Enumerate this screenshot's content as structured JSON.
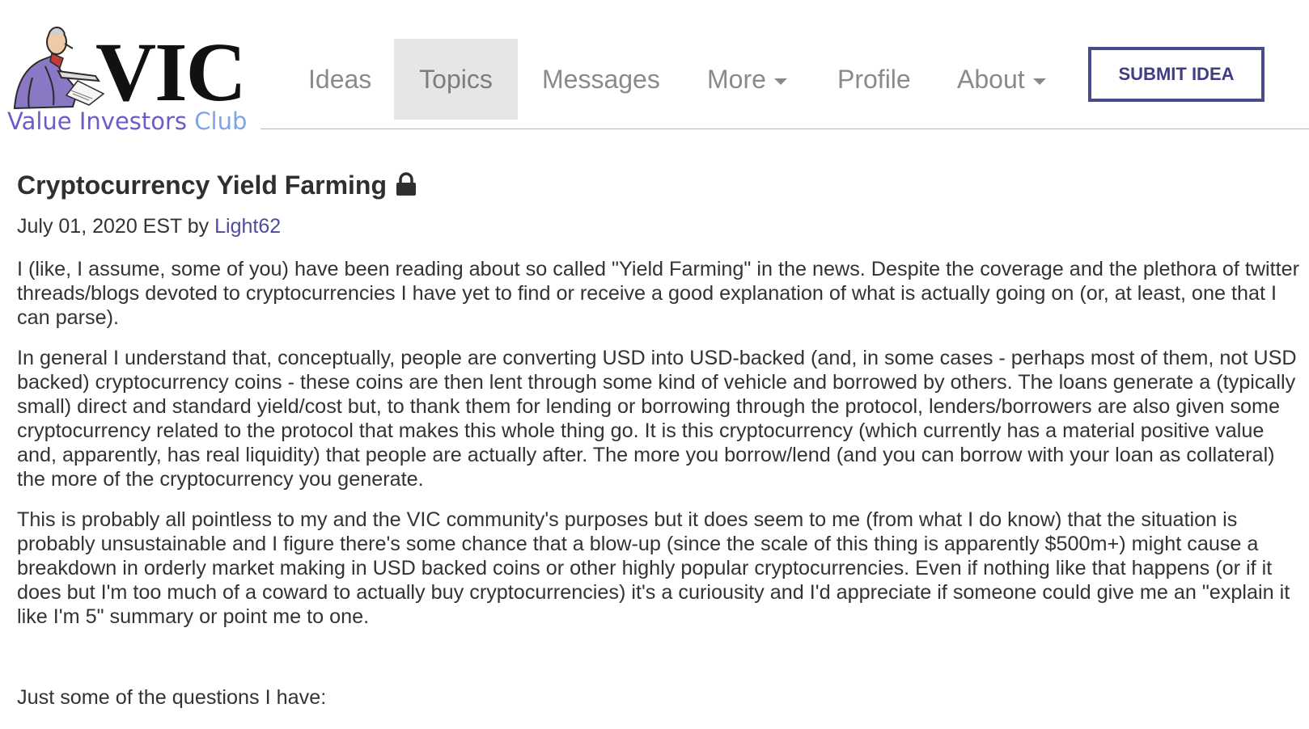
{
  "site": {
    "logo_text": "VIC",
    "tagline_part1": "Value Investors",
    "tagline_part2": "Club"
  },
  "nav": {
    "ideas": "Ideas",
    "topics": "Topics",
    "messages": "Messages",
    "more": "More",
    "profile": "Profile",
    "about": "About",
    "submit": "SUBMIT IDEA",
    "active_item": "Topics"
  },
  "post": {
    "title": "Cryptocurrency Yield Farming",
    "date": "July 01, 2020 EST by ",
    "author": "Light62",
    "paragraphs": [
      "I (like, I assume, some of you) have been reading about so called \"Yield Farming\" in the news.  Despite the coverage and the plethora of twitter threads/blogs devoted to cryptocurrencies I have yet to find or receive a good explanation of what is actually going on (or, at least, one that I can parse).",
      "In general I understand that, conceptually, people are converting USD into USD-backed (and, in some cases - perhaps most of them, not USD backed) cryptocurrency coins - these coins are then lent through some kind of vehicle and borrowed by others.  The loans generate a (typically small) direct and standard yield/cost but, to thank them for lending or borrowing through the protocol, lenders/borrowers are also given some cryptocurrency related to the protocol that makes this whole thing go.  It is this cryptocurrency (which currently has a material positive value and, apparently, has real liquidity) that people are actually after.  The more you borrow/lend (and you can borrow with your loan as collateral) the more of the cryptocurrency you generate.",
      "This is probably all pointless to my and the VIC community's purposes but it does seem to me (from what I do know) that the situation is probably unsustainable and I figure there's some chance that a blow-up (since the scale of this thing is apparently $500m+) might cause a breakdown in orderly market making in USD backed coins or other highly popular cryptocurrencies.  Even if nothing like that happens (or if it does but I'm too much of a coward to actually buy cryptocurrencies) it's a curiousity and I'd appreciate if someone could give me an \"explain it like I'm 5\" summary or point me to one.",
      "Just some of the questions I have:"
    ]
  },
  "colors": {
    "brand_purple": "#4b4a8c",
    "link": "#4f4aa0",
    "nav_text": "#8a8a8a",
    "nav_active_bg": "#e6e6e6"
  },
  "icons": {
    "logo_figure": "investor-cartoon-icon",
    "lock": "lock-icon",
    "caret": "caret-down-icon"
  }
}
